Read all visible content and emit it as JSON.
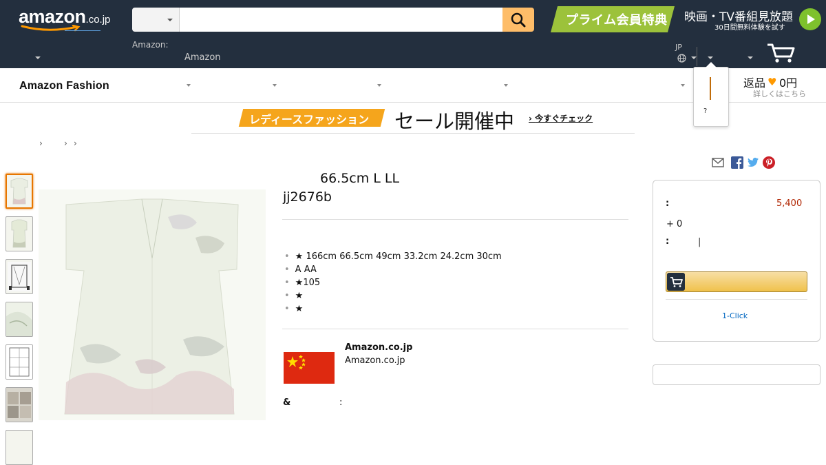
{
  "header": {
    "logo_text": "amazon",
    "logo_tld": ".co.jp",
    "search": {
      "category_value": "",
      "query": ""
    },
    "prime_banner_label": "プライム会員特典",
    "video_line1": "映画・TV番組見放題",
    "video_line2": "30日間無料体験を試す",
    "deliver_label": "Amazon:",
    "deliver_value": "Amazon",
    "language": "JP",
    "account_popover_text": "?"
  },
  "subnav": {
    "title": "Amazon Fashion",
    "returns_label": "返品",
    "returns_heart": "♥",
    "returns_amount": "0円",
    "returns_sub": "詳しくはこちら"
  },
  "promo": {
    "tag": "レディースファッション",
    "title": "セール開催中",
    "cta": "今すぐチェック"
  },
  "breadcrumb": {
    "separators": [
      "›",
      "›",
      "›"
    ]
  },
  "product": {
    "title_line1": "66.5cm  L LL",
    "title_line2": "jj2676b",
    "bullets": [
      "★  166cm 66.5cm 49cm 33.2cm 24.2cm 30cm",
      "A AA",
      "★105",
      "★",
      "★"
    ],
    "bullet_dot": "•",
    "seller_name": "Amazon.co.jp",
    "seller_sub": "Amazon.co.jp",
    "amp_label": "&",
    "colon_label": ":"
  },
  "share_icons": [
    "mail-icon",
    "facebook-icon",
    "twitter-icon",
    "pinterest-icon"
  ],
  "buy_box": {
    "price_colon": ":",
    "price_value": "5,400",
    "points": "+  0",
    "qty_colon": ":",
    "qty_cursor": "|",
    "one_click": "1-Click"
  },
  "colors": {
    "nav_bg": "#232f3e",
    "search_button": "#febd69",
    "prime_green": "#7ec12d",
    "promo_orange": "#f5a51c",
    "price_red": "#b12704",
    "link_blue": "#0066c0"
  }
}
